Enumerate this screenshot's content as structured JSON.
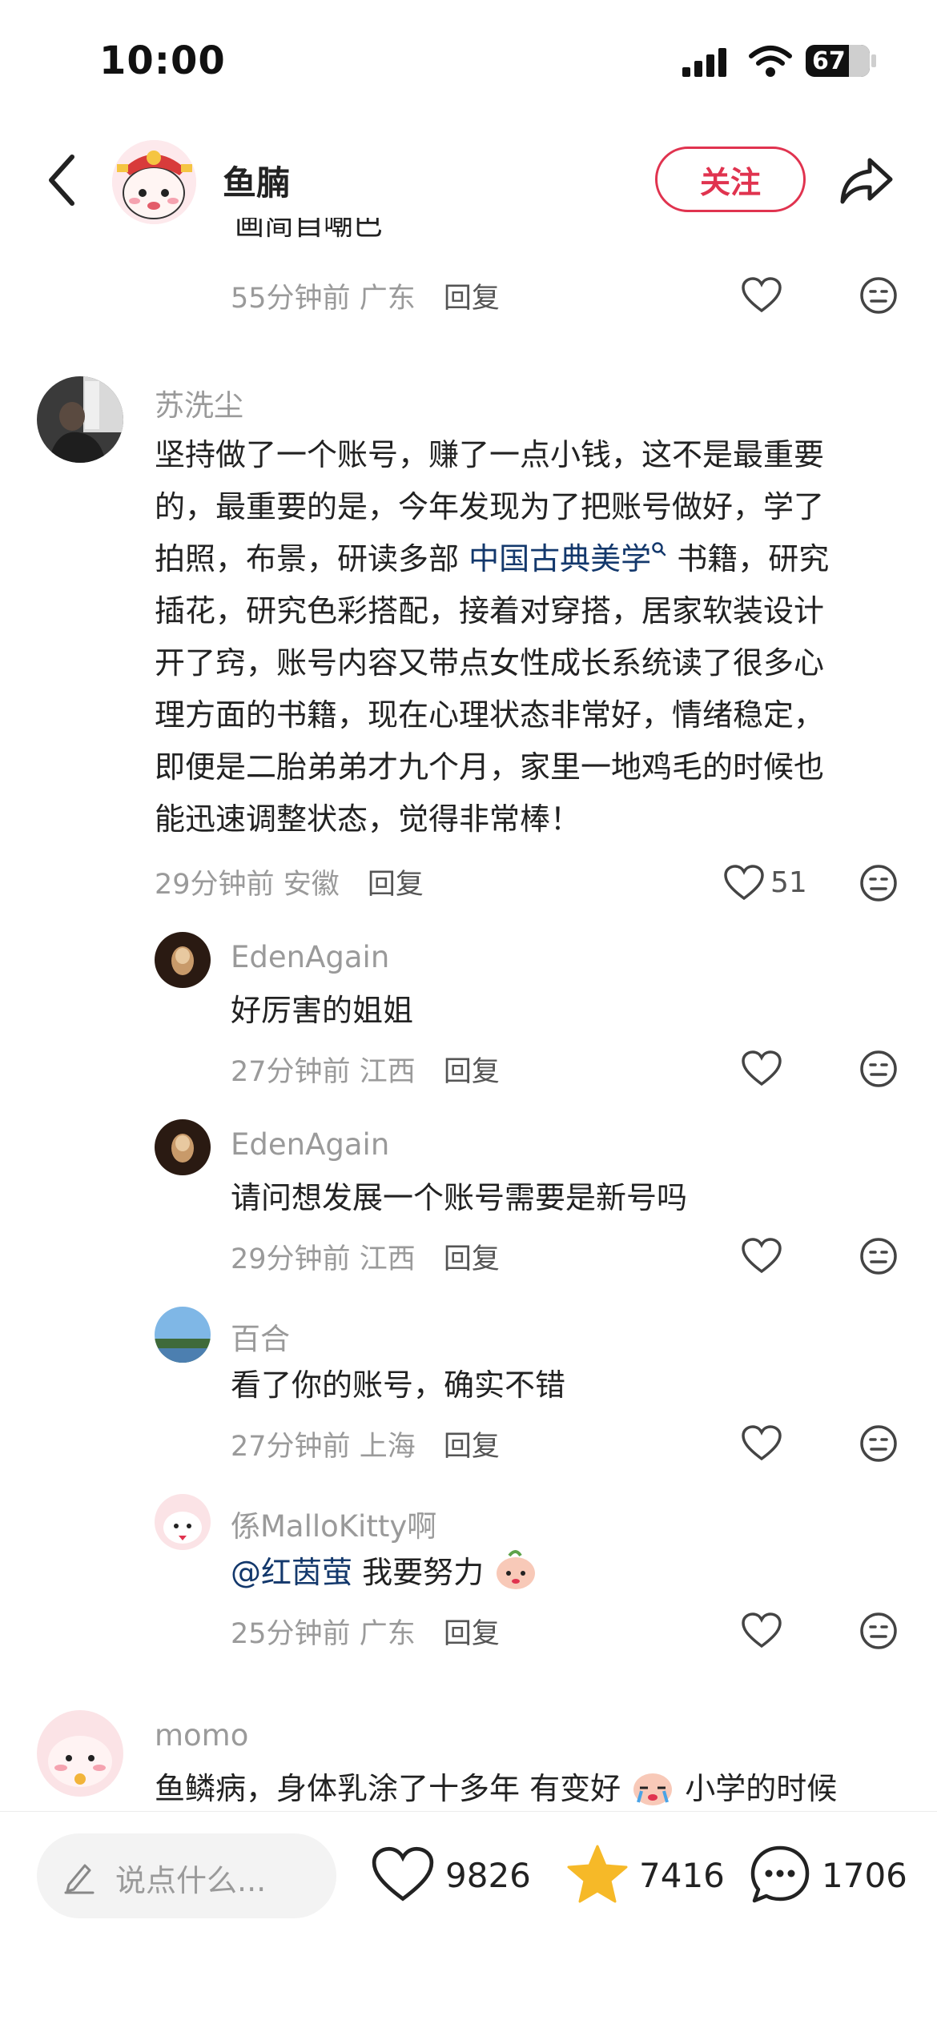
{
  "status_bar": {
    "time": "10:00",
    "battery": "67"
  },
  "nav": {
    "author_name": "鱼腩",
    "follow_label": "关注"
  },
  "prev_comment": {
    "text_fragment": "画简自嘲巴",
    "time": "55分钟前",
    "location": "广东",
    "reply_label": "回复"
  },
  "main_comment": {
    "username": "苏洗尘",
    "text_lines": [
      "坚持做了一个账号，赚了一点小钱，这不是最重要",
      "的，最重要的是，今年发现为了把账号做好，学了",
      "插花，研究色彩搭配，接着对穿搭，居家软装设计",
      "开了窍，账号内容又带点女性成长系统读了很多心",
      "理方面的书籍，现在心理状态非常好，情绪稳定，",
      "即便是二胎弟弟才九个月，家里一地鸡毛的时候也",
      "能迅速调整状态，觉得非常棒！"
    ],
    "line3_prefix": "拍照，布景，研读多部",
    "line3_link": "中国古典美学",
    "line3_suffix": "书籍，研究",
    "time": "29分钟前",
    "location": "安徽",
    "reply_label": "回复",
    "likes": "51"
  },
  "replies": [
    {
      "username": "EdenAgain",
      "text": "好厉害的姐姐",
      "time": "27分钟前",
      "location": "江西",
      "reply_label": "回复"
    },
    {
      "username": "EdenAgain",
      "text": "请问想发展一个账号需要是新号吗",
      "time": "29分钟前",
      "location": "江西",
      "reply_label": "回复"
    },
    {
      "username": "百合",
      "text": "看了你的账号，确实不错",
      "time": "27分钟前",
      "location": "上海",
      "reply_label": "回复"
    },
    {
      "username": "係MalloKitty啊",
      "mention": "@红茵萤",
      "text": "我要努力",
      "time": "25分钟前",
      "location": "广东",
      "reply_label": "回复"
    }
  ],
  "next_comment": {
    "username": "momo",
    "text_before": "鱼鳞病，身体乳涂了十多年 有变好",
    "text_after": "小学的时候"
  },
  "bottom_bar": {
    "input_placeholder": "说点什么...",
    "likes": "9826",
    "stars": "7416",
    "comments": "1706"
  },
  "colors": {
    "accent": "#e0334f",
    "link": "#13386c",
    "star": "#f6b928",
    "meta": "#9a9a9a"
  }
}
